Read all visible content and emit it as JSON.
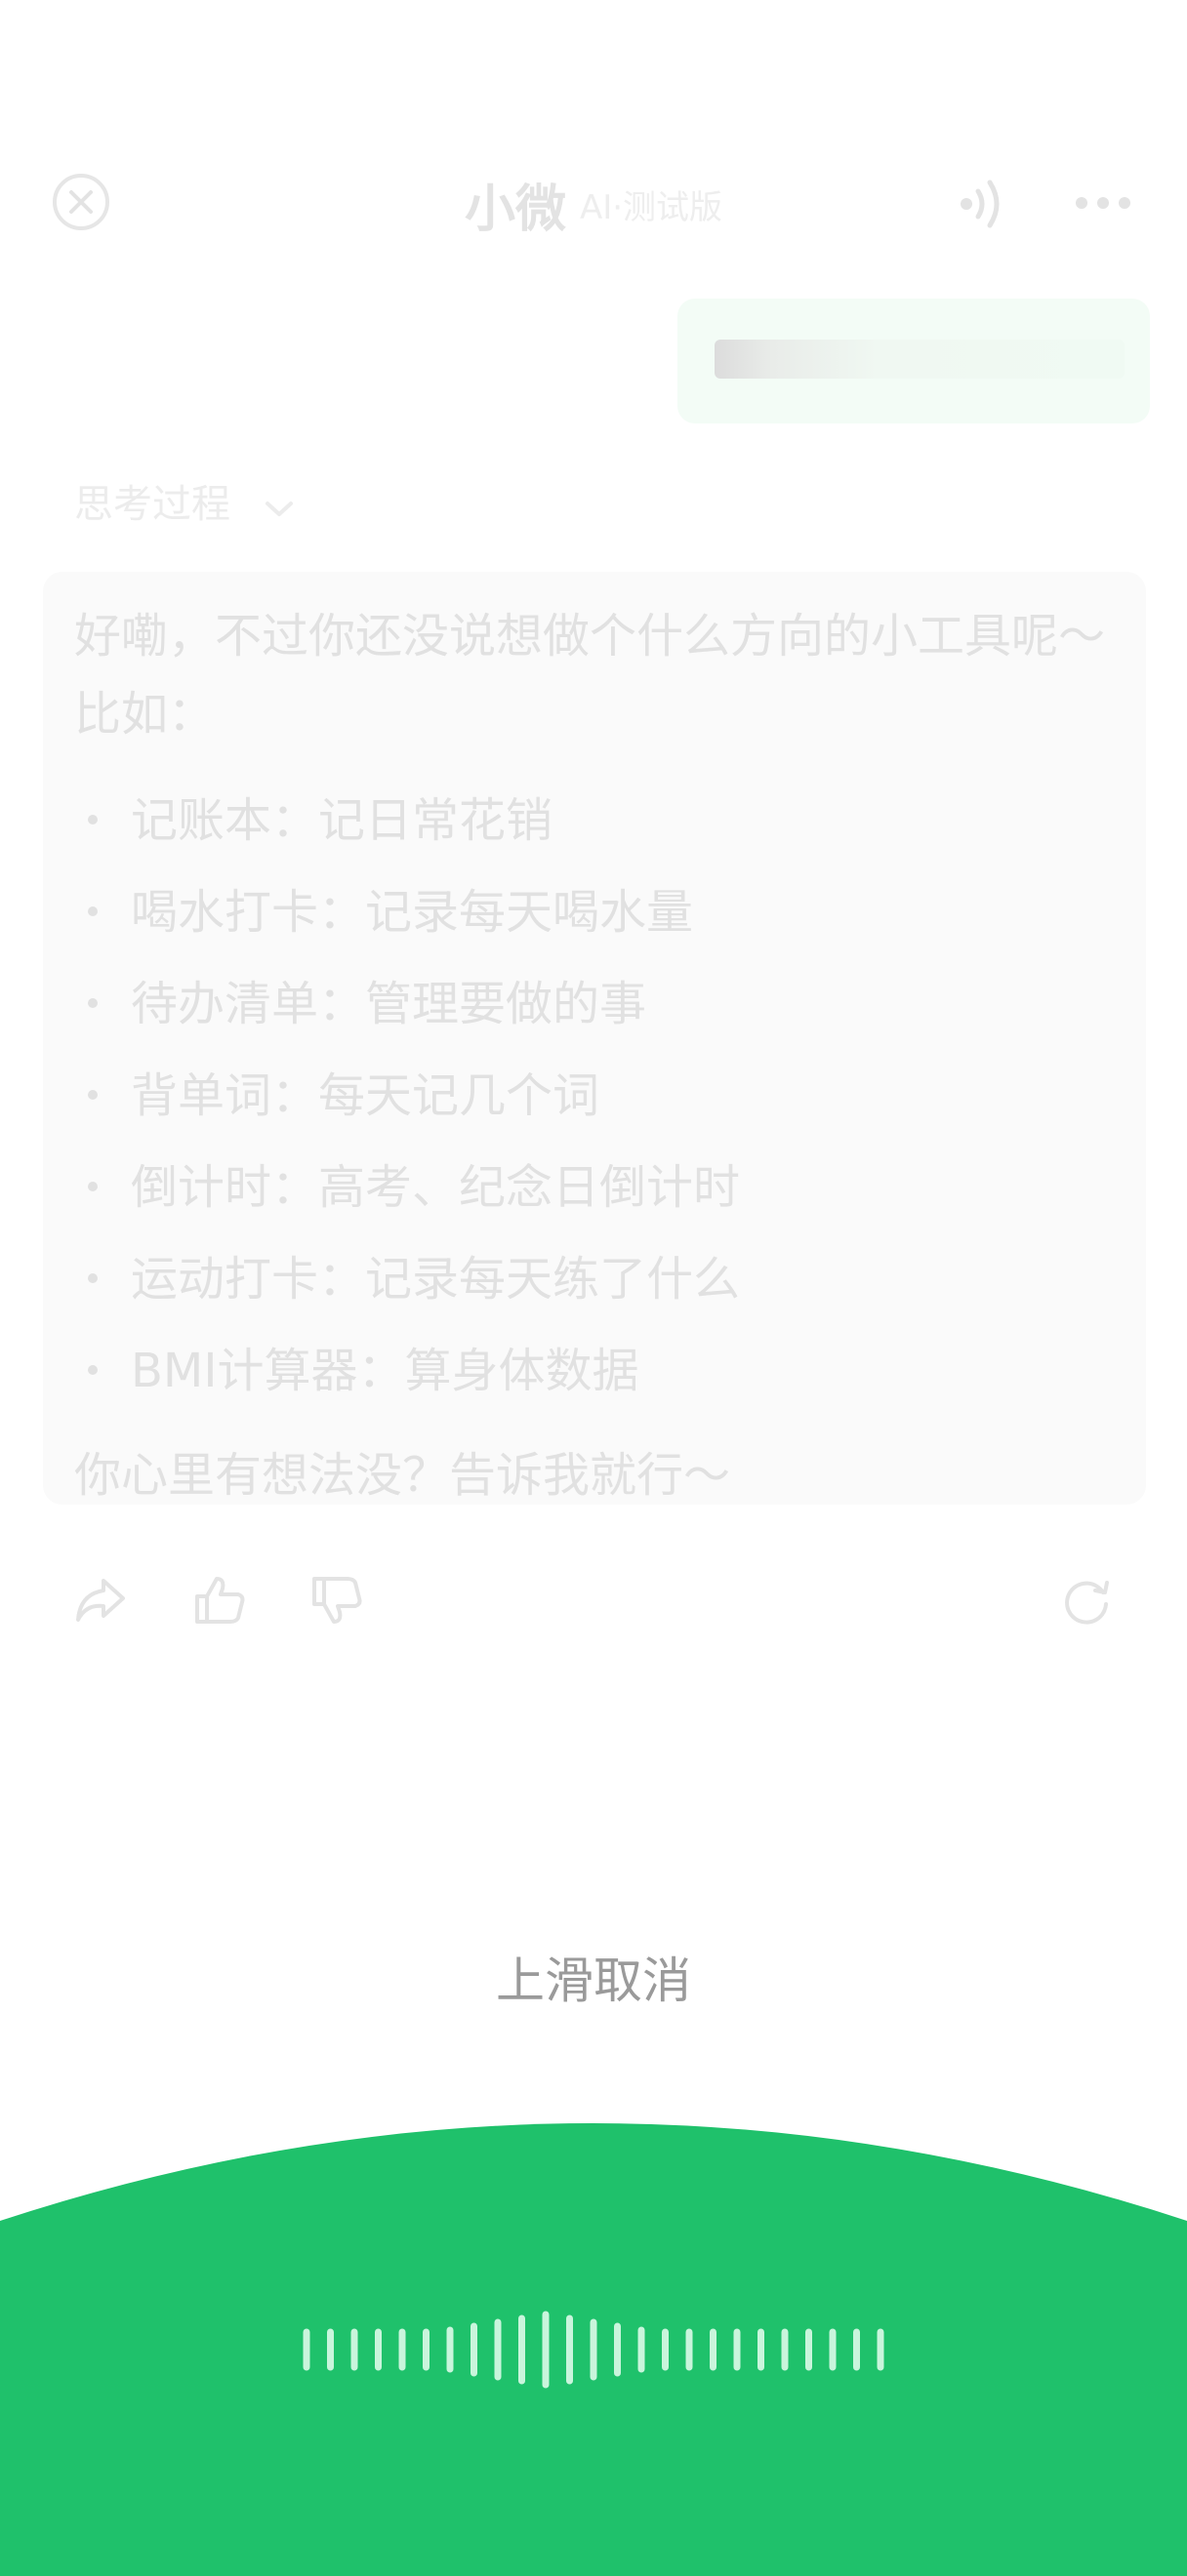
{
  "header": {
    "title": "小微",
    "badge": "AI·测试版"
  },
  "thinking": {
    "label": "思考过程"
  },
  "reply": {
    "intro": "好嘞，不过你还没说想做个什么方向的小工具呢～比如：",
    "items": [
      "记账本：记日常花销",
      "喝水打卡：记录每天喝水量",
      "待办清单：管理要做的事",
      "背单词：每天记几个词",
      "倒计时：高考、纪念日倒计时",
      "运动打卡：记录每天练了什么",
      "BMI计算器：算身体数据"
    ],
    "outro": "你心里有想法没？告诉我就行～"
  },
  "recording": {
    "cancel_hint": "上滑取消",
    "level": 0.3
  },
  "colors": {
    "accent": "#1fc16b",
    "wave": "#c9f5dc"
  },
  "icons": {
    "close": "close-circle-icon",
    "speaker": "speaker-icon",
    "more": "more-dots-icon",
    "share": "share-icon",
    "like": "thumbs-up-icon",
    "dislike": "thumbs-down-icon",
    "regenerate": "refresh-icon"
  }
}
